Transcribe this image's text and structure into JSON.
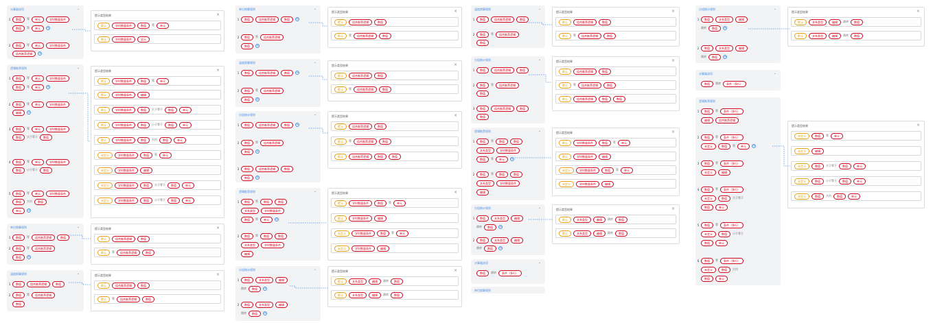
{
  "panel_title": "提示类型结果",
  "close_glyph": "×",
  "tokens": {
    "num": "数值",
    "mf": "学时数量条件",
    "doc": "单元",
    "op": "等",
    "le": "小于等于",
    "ge": "大于等于",
    "ap": "大约",
    "mx": "组合推荐逻辑",
    "ui": "编辑",
    "cmt": "未定义",
    "lg": "条件（多行）",
    "rst": "跳转",
    "eq": "关系类型",
    "vv": "默认",
    "ok": "显示"
  },
  "groups": [
    {
      "title": "计算器选项"
    },
    {
      "title": "逻辑推荐规则"
    },
    {
      "title": "单位换算规则"
    },
    {
      "title": "温度换算规则"
    },
    {
      "title": "分组统计规则"
    }
  ]
}
